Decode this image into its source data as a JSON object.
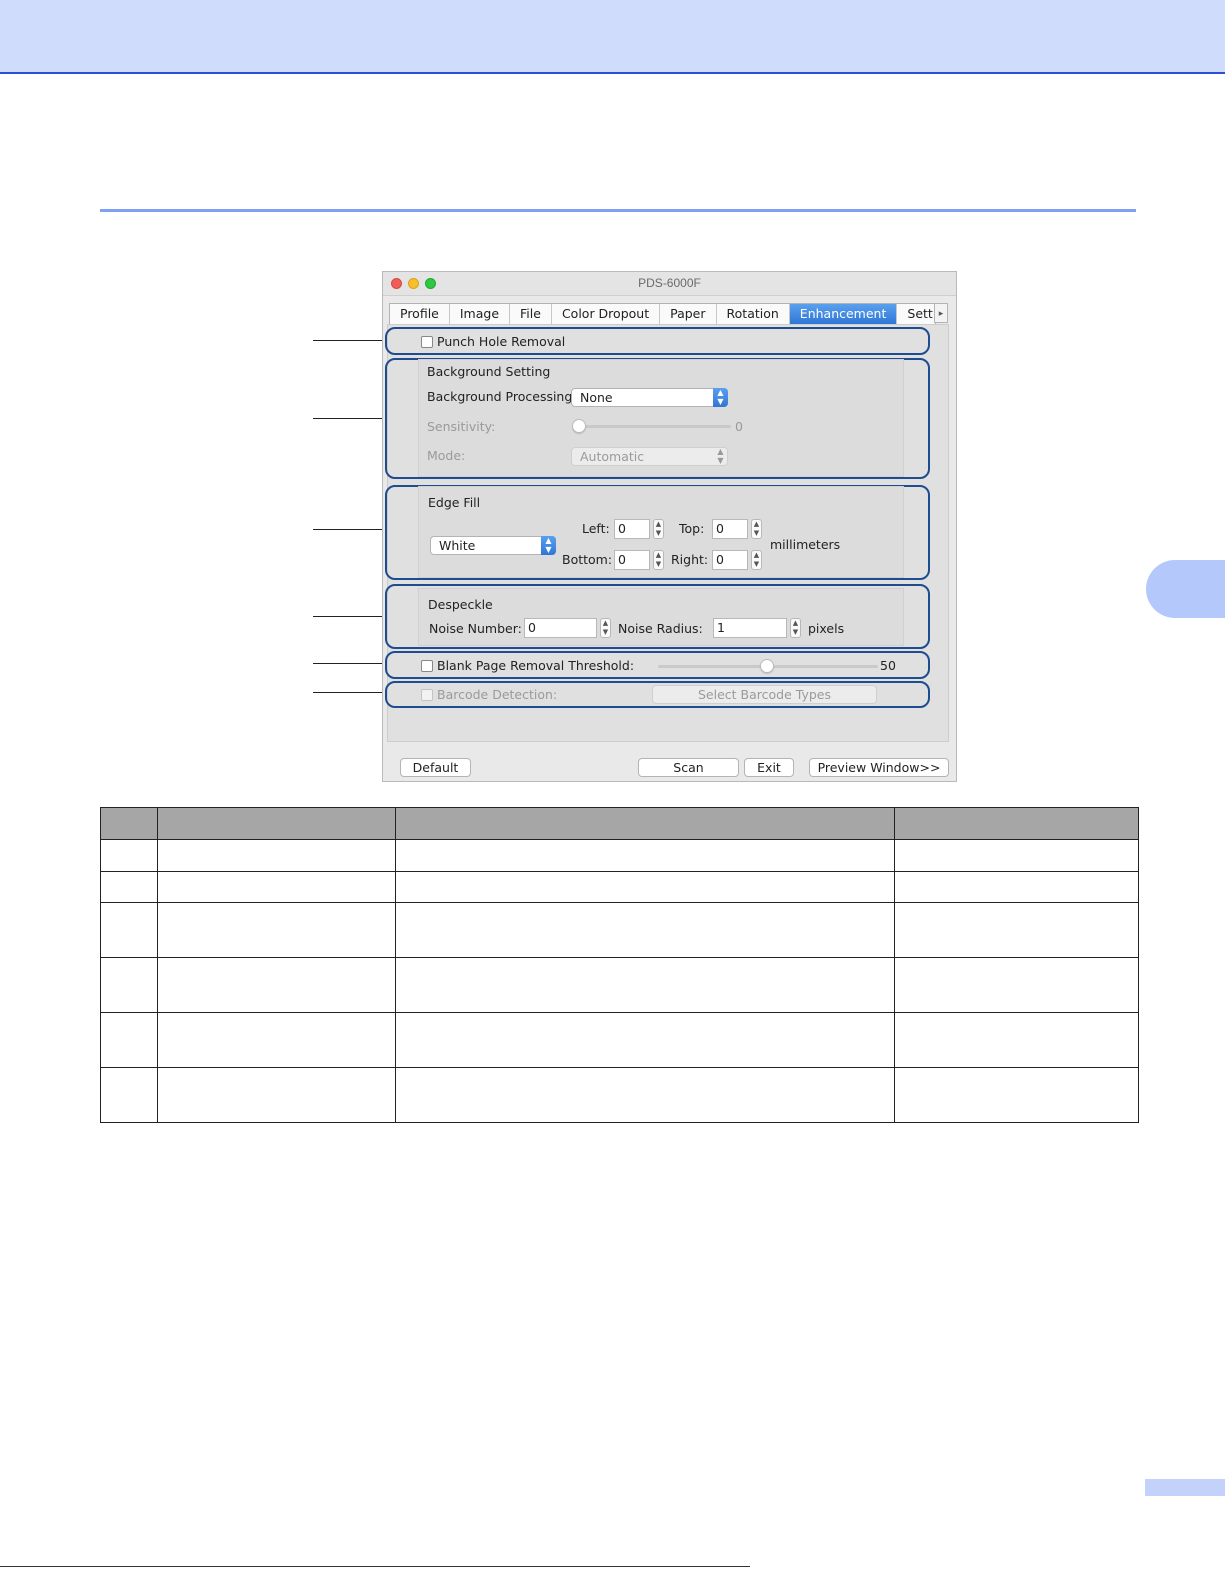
{
  "window": {
    "title": "PDS-6000F",
    "tabs": [
      "Profile",
      "Image",
      "File",
      "Color Dropout",
      "Paper",
      "Rotation",
      "Enhancement",
      "Settin"
    ],
    "active_tab": "Enhancement",
    "tab_scroll_glyph": "▸"
  },
  "punch_hole": {
    "label": "Punch Hole Removal",
    "checked": false
  },
  "background_setting": {
    "title": "Background Setting",
    "processing_label": "Background Processing:",
    "processing_value": "None",
    "sensitivity_label": "Sensitivity:",
    "sensitivity_value": "0",
    "sensitivity_level": 0,
    "mode_label": "Mode:",
    "mode_value": "Automatic"
  },
  "edge_fill": {
    "title": "Edge Fill",
    "color_value": "White",
    "left_label": "Left:",
    "left_value": "0",
    "top_label": "Top:",
    "top_value": "0",
    "bottom_label": "Bottom:",
    "bottom_value": "0",
    "right_label": "Right:",
    "right_value": "0",
    "unit": "millimeters"
  },
  "despeckle": {
    "title": "Despeckle",
    "noise_number_label": "Noise Number:",
    "noise_number_value": "0",
    "noise_radius_label": "Noise Radius:",
    "noise_radius_value": "1",
    "unit": "pixels"
  },
  "blank_page": {
    "label": "Blank Page Removal Threshold:",
    "value": "50",
    "level": 0.5,
    "checked": false
  },
  "barcode": {
    "label": "Barcode Detection:",
    "button": "Select Barcode Types",
    "enabled": false
  },
  "buttons": {
    "default": "Default",
    "scan": "Scan",
    "exit": "Exit",
    "preview": "Preview Window>>"
  },
  "colors": {
    "accent": "#3f8ae3",
    "callout_border": "#1e4c8f",
    "header_band": "#cfdcfb",
    "rule": "#7ea0f5",
    "table_header": "#a6a6a6"
  }
}
